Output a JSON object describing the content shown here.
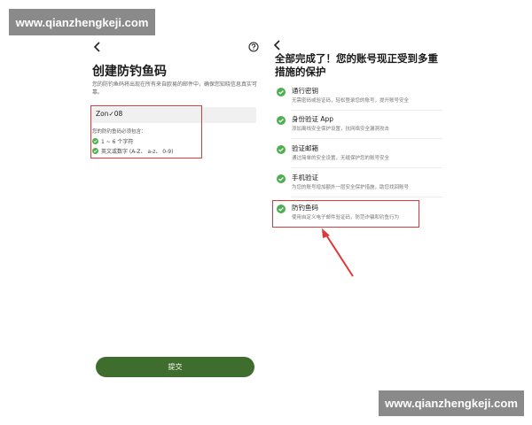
{
  "watermarks": {
    "top": "www.qianzhengkeji.com",
    "bottom": "www.qianzhengkeji.com"
  },
  "left_screen": {
    "back_icon": "chevron-left-icon",
    "help_icon": "question-circle-icon",
    "title": "创建防钓鱼码",
    "description": "您的防钓鱼码将出现在所有来自欧易的邮件中，确保您知晓信息真实可靠。",
    "input_value": "Zon✓08",
    "requirements_title": "您的防钓鱼码必须包含：",
    "requirements": [
      "1 ~ 6 个字符",
      "英文或数字 (A-Z、 a-z、 0-9)"
    ],
    "submit_label": "提交"
  },
  "right_screen": {
    "back_icon": "chevron-left-icon",
    "title": "全部完成了！您的账号现正受到多重措施的保护",
    "items": [
      {
        "title": "通行密钥",
        "desc": "无需密码或验证码，轻松登录您的账号，提升账号安全"
      },
      {
        "title": "身份验证 App",
        "desc": "添加离线安全保护设置，抗网络安全漏洞攻击"
      },
      {
        "title": "验证邮箱",
        "desc": "通过简单的安全设置，无缝保护您的账号安全"
      },
      {
        "title": "手机验证",
        "desc": "为您的账号增加额外一层安全保护措施，助您找回账号"
      },
      {
        "title": "防钓鱼码",
        "desc": "使用自定义电子邮件验证码，防范诈骗和钓鱼行为"
      }
    ]
  },
  "colors": {
    "accent_green": "#3f6d2d",
    "check_green": "#4caf50",
    "highlight_red": "#d93a3a",
    "watermark_gray": "#8a8a8a"
  }
}
